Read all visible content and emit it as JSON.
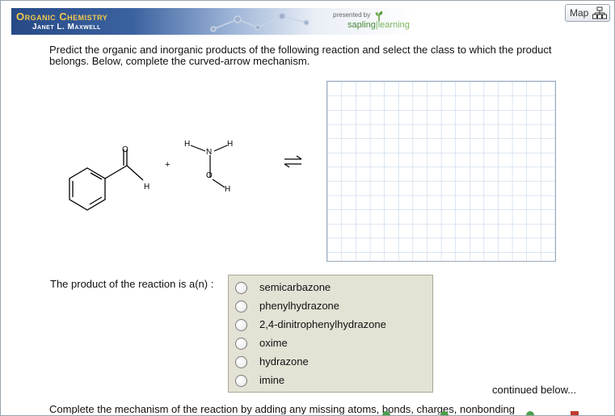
{
  "banner": {
    "title": "Organic Chemistry",
    "author": "Janet L. Maxwell",
    "presented_by": "presented by",
    "logo_left": "sapling",
    "logo_right": "learning"
  },
  "map_button": {
    "label": "Map",
    "icon": "sitemap-icon"
  },
  "question": {
    "text": "Predict the organic and inorganic products of the following reaction and select the class to which the product belongs. Below, complete the curved-arrow mechanism."
  },
  "reaction": {
    "plus": "+",
    "h": "H",
    "n": "N",
    "o": "O",
    "equilibrium_icon": "equilibrium-arrows-icon"
  },
  "product_prompt": "The product of the reaction is a(n) :",
  "choices": [
    {
      "label": "semicarbazone"
    },
    {
      "label": "phenylhydrazone"
    },
    {
      "label": "2,4-dinitrophenylhydrazone"
    },
    {
      "label": "oxime"
    },
    {
      "label": "hydrazone"
    },
    {
      "label": "imine"
    }
  ],
  "continued": "continued below...",
  "mechanism_prompt": "Complete the mechanism of the reaction by adding any missing atoms, bonds, charges, nonbonding"
}
